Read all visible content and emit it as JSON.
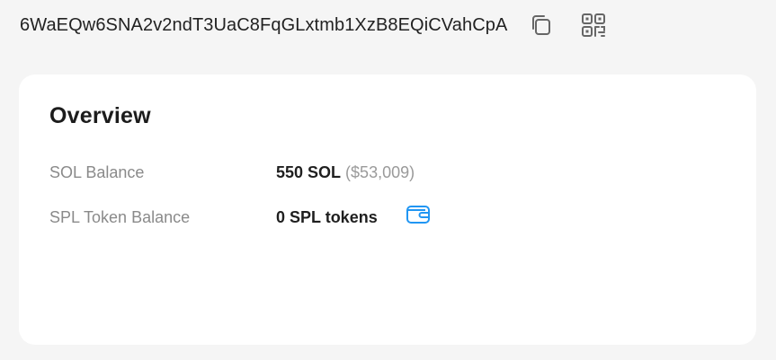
{
  "address": {
    "value": "6WaEQw6SNA2v2ndT3UaC8FqGLxtmb1XzB8EQiCVahCpA",
    "copy_icon": "copy-icon",
    "qr_icon": "qr-code-icon"
  },
  "overview": {
    "title": "Overview",
    "sol_balance": {
      "label": "SOL Balance",
      "value": "550 SOL",
      "usd": "($53,009)"
    },
    "spl_balance": {
      "label": "SPL Token Balance",
      "value": "0 SPL tokens",
      "icon": "wallet-icon"
    }
  },
  "colors": {
    "background": "#f5f5f5",
    "card": "#ffffff",
    "accent": "#2196f3",
    "muted_text": "#8a8a8a"
  }
}
